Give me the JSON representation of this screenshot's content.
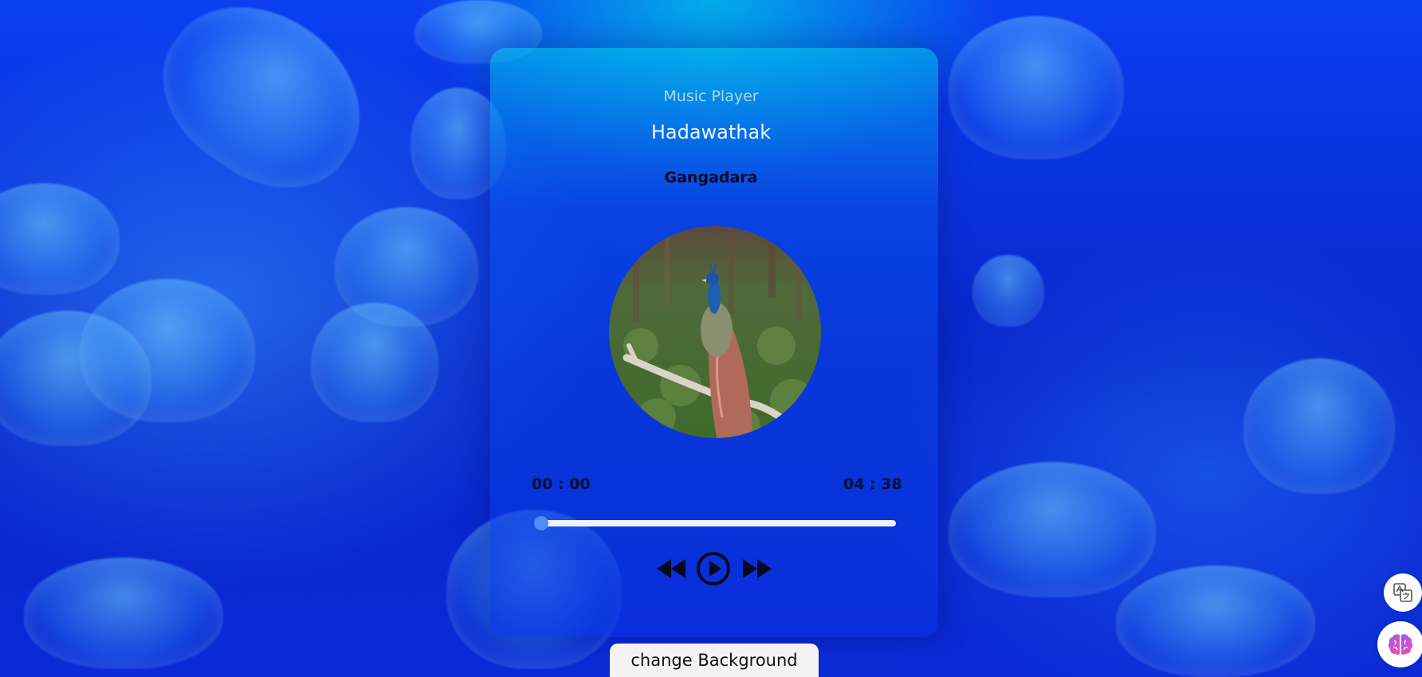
{
  "player": {
    "app_title": "Music Player",
    "song_title": "Hadawathak",
    "artist": "Gangadara",
    "current_time": "00 : 00",
    "duration": "04 : 38",
    "progress": 0
  },
  "buttons": {
    "change_background": "change Background"
  },
  "icons": {
    "previous": "rewind-icon",
    "play": "play-circle-icon",
    "next": "fast-forward-icon",
    "translate": "translate-icon",
    "assistant": "brain-icon"
  },
  "colors": {
    "background": "#0a2fe0",
    "progress_track": "#eef2ff",
    "progress_thumb": "#4f8dff"
  }
}
